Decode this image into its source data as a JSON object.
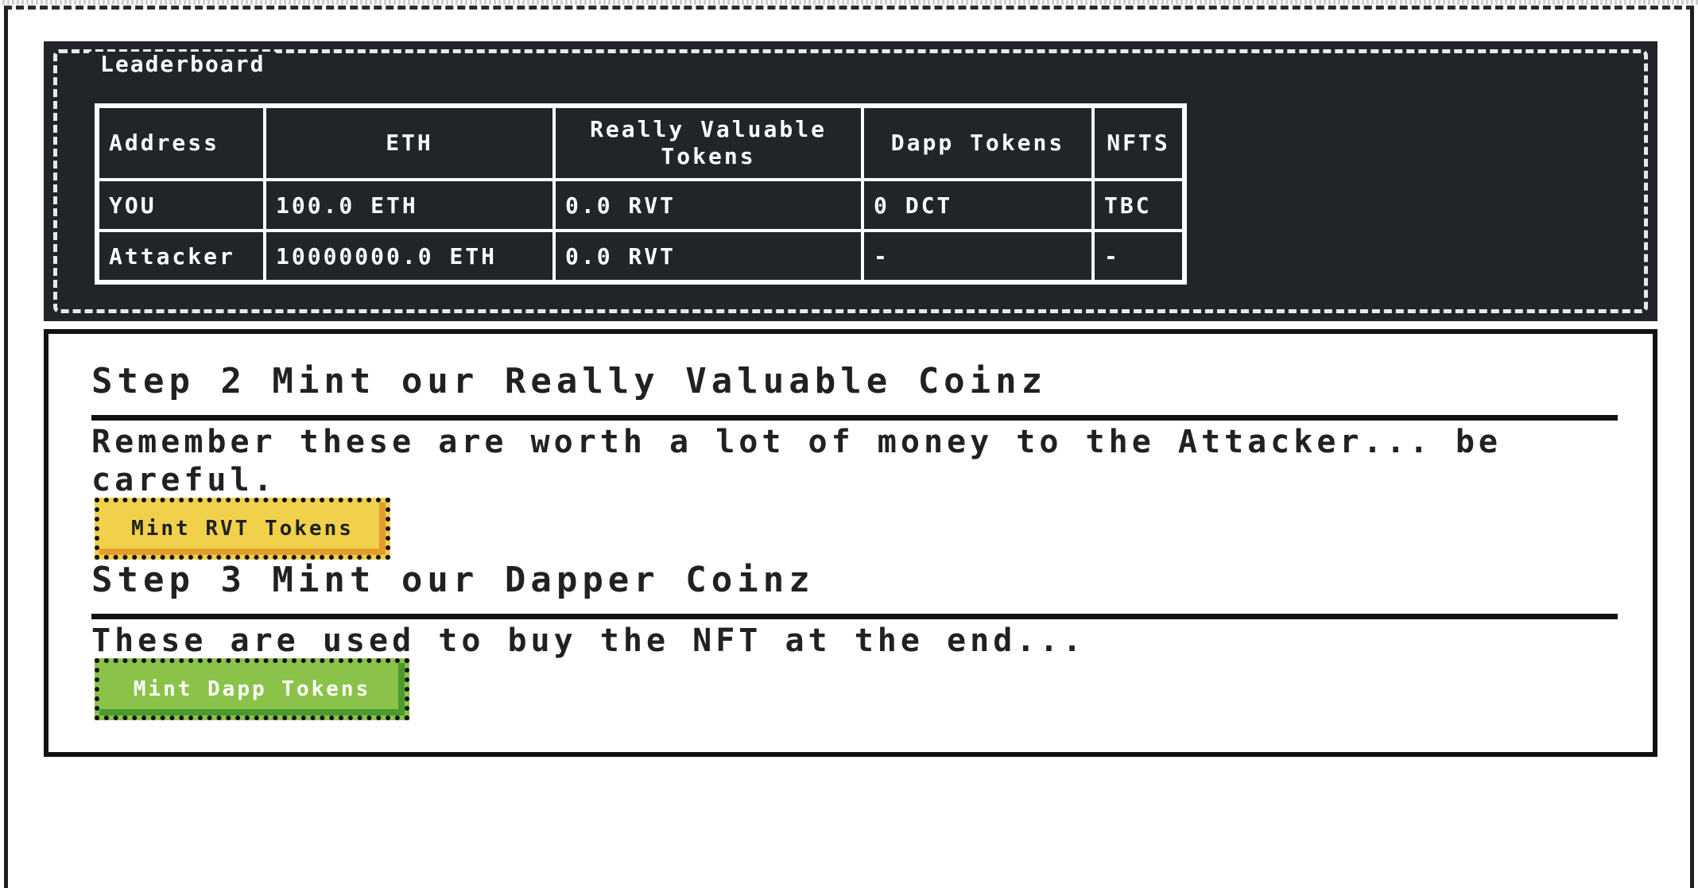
{
  "leaderboard": {
    "title": "Leaderboard",
    "headers": [
      "Address",
      "ETH",
      "Really Valuable Tokens",
      "Dapp Tokens",
      "NFTS"
    ],
    "rows": [
      [
        "YOU",
        "100.0 ETH",
        "0.0 RVT",
        "0 DCT",
        "TBC"
      ],
      [
        "Attacker",
        "10000000.0 ETH",
        "0.0 RVT",
        "-",
        "-"
      ]
    ]
  },
  "step2": {
    "title": "Step 2 Mint our Really Valuable Coinz",
    "text": "Remember these are worth a lot of money to the Attacker... be careful.",
    "button_label": "Mint RVT Tokens"
  },
  "step3": {
    "title": "Step 3 Mint our Dapper Coinz",
    "text": "These are used to buy the NFT at the end...",
    "button_label": "Mint Dapp Tokens"
  },
  "colors": {
    "panel_dark": "#212529",
    "button_yellow": "#f1d14b",
    "button_green": "#8bc34a"
  }
}
